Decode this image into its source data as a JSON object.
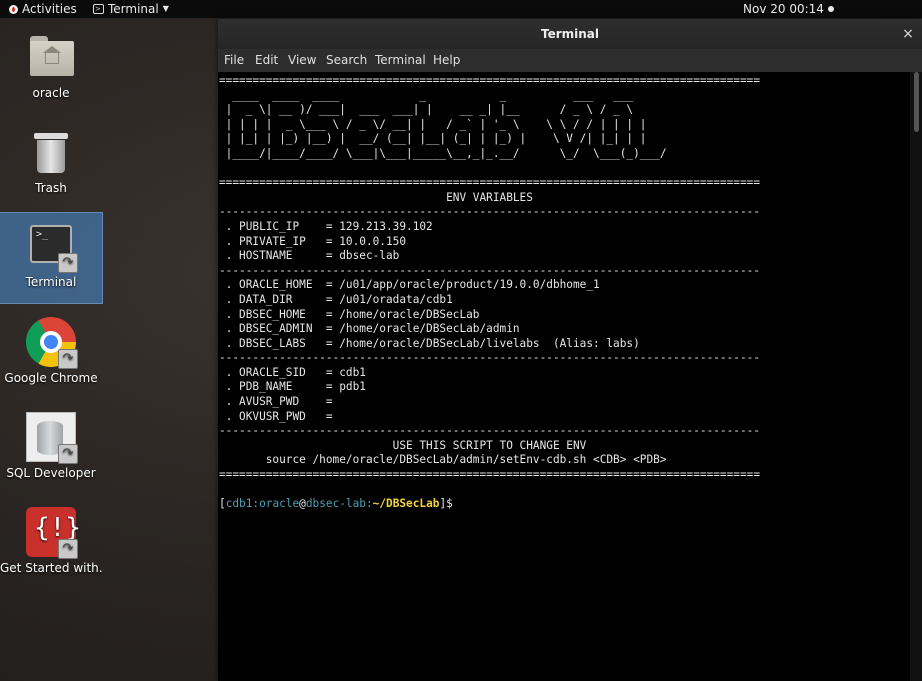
{
  "topbar": {
    "activities": "Activities",
    "app_menu": "Terminal",
    "clock": "Nov 20  00:14"
  },
  "desktop": {
    "icons": [
      {
        "label": "oracle",
        "icon": "home-folder-icon"
      },
      {
        "label": "Trash",
        "icon": "trash-icon"
      },
      {
        "label": "Terminal",
        "icon": "terminal-icon"
      },
      {
        "label": "Google Chrome",
        "icon": "chrome-icon"
      },
      {
        "label": "SQL Developer",
        "icon": "sql-developer-icon"
      },
      {
        "label": "Get Started with...",
        "icon": "get-started-icon"
      }
    ]
  },
  "window": {
    "title": "Terminal",
    "close": "×",
    "menu": [
      "File",
      "Edit",
      "View",
      "Search",
      "Terminal",
      "Help"
    ]
  },
  "terminal": {
    "lines": [
      "=================================================================================",
      "  ____  ____  ____            _           _          ___   ___",
      " |  _ \\| __ )/ ___|  ___  ___| |    __ _| |__      / _ \\ / _ \\",
      " | | | |  _ \\___ \\ / _ \\/ __| |   / _` | '_ \\    \\ \\ / / | | | |",
      " | |_| | |_) |__) |  __/ (__| |__| (_| | |_) |    \\ V /| |_| | |",
      " |____/|____/____/ \\___|\\___|_____\\__,_|_.__/      \\_/  \\___(_)___/",
      "",
      "=================================================================================",
      "                                  ENV VARIABLES",
      "---------------------------------------------------------------------------------",
      " . PUBLIC_IP    = 129.213.39.102",
      " . PRIVATE_IP   = 10.0.0.150",
      " . HOSTNAME     = dbsec-lab",
      "---------------------------------------------------------------------------------",
      " . ORACLE_HOME  = /u01/app/oracle/product/19.0.0/dbhome_1",
      " . DATA_DIR     = /u01/oradata/cdb1",
      " . DBSEC_HOME   = /home/oracle/DBSecLab",
      " . DBSEC_ADMIN  = /home/oracle/DBSecLab/admin",
      " . DBSEC_LABS   = /home/oracle/DBSecLab/livelabs  (Alias: labs)",
      "---------------------------------------------------------------------------------",
      " . ORACLE_SID   = cdb1",
      " . PDB_NAME     = pdb1",
      " . AVUSR_PWD    =",
      " . OKVUSR_PWD   =",
      "---------------------------------------------------------------------------------",
      "                          USE THIS SCRIPT TO CHANGE ENV",
      "       source /home/oracle/DBSecLab/admin/setEnv-cdb.sh <CDB> <PDB>",
      "================================================================================="
    ],
    "prompt": {
      "open": "[",
      "userhost": "cdb1:oracle",
      "at": "@",
      "host": "dbsec-lab:",
      "path": "~/DBSecLab",
      "close": "]$"
    }
  }
}
